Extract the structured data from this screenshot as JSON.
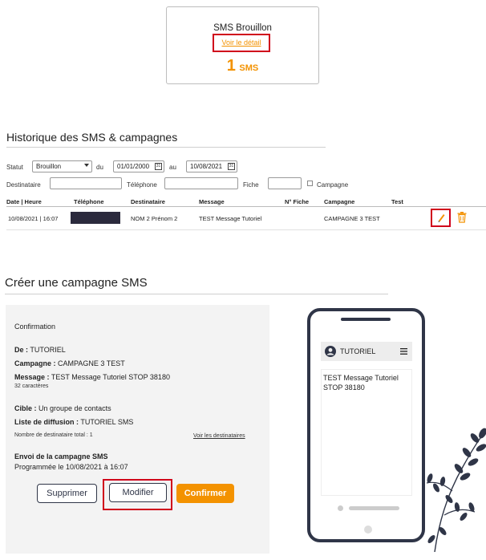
{
  "sms_card": {
    "title": "SMS Brouillon",
    "detail_link": "Voir le détail",
    "count": "1",
    "count_unit": "SMS"
  },
  "history": {
    "title": "Historique des SMS & campagnes",
    "filters": {
      "statut_label": "Statut",
      "statut_value": "Brouillon",
      "du_label": "du",
      "date_from": "01/01/2000",
      "au_label": "au",
      "date_to": "10/08/2021",
      "destinataire_label": "Destinataire",
      "telephone_label": "Téléphone",
      "fiche_label": "Fiche",
      "campagne_label": "Campagne"
    },
    "columns": [
      "Date | Heure",
      "Téléphone",
      "Destinataire",
      "Message",
      "N° Fiche",
      "Campagne",
      "Test"
    ],
    "rows": [
      {
        "date": "10/08/2021 | 16:07",
        "destinataire": "NOM 2 Prénom 2",
        "message": "TEST Message Tutoriel",
        "fiche": "",
        "campagne": "CAMPAGNE 3 TEST"
      }
    ]
  },
  "create": {
    "title": "Créer une campagne SMS",
    "confirmation_heading": "Confirmation",
    "de_label": "De :",
    "de_value": "TUTORIEL",
    "campagne_label": "Campagne :",
    "campagne_value": "CAMPAGNE 3 TEST",
    "message_label": "Message :",
    "message_value": "TEST Message Tutoriel STOP 38180",
    "char_count": "32 caractères",
    "cible_label": "Cible :",
    "cible_value": "Un groupe de contacts",
    "liste_label": "Liste de diffusion :",
    "liste_value": "TUTORIEL SMS",
    "total_dest": "Nombre de destinataire total : 1",
    "voir_dest": "Voir les destinataires",
    "envoi_heading": "Envoi de la campagne SMS",
    "programmee": "Programmée le 10/08/2021 à 16:07",
    "buttons": {
      "supprimer": "Supprimer",
      "modifier": "Modifier",
      "confirmer": "Confirmer"
    }
  },
  "phone": {
    "user": "TUTORIEL",
    "message": "TEST Message Tutoriel STOP 38180"
  },
  "colors": {
    "accent": "#f39200",
    "highlight": "#d0021b",
    "dark": "#2f3547",
    "redacted": "#2b2a3d"
  }
}
